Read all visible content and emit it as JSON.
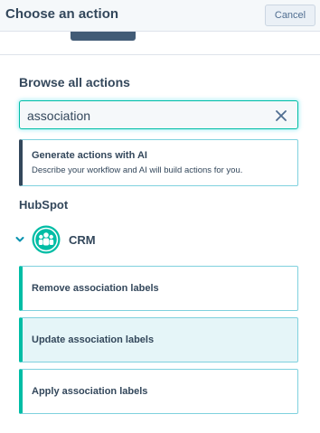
{
  "header": {
    "title": "Choose an action",
    "cancel_label": "Cancel"
  },
  "browse": {
    "title": "Browse all actions"
  },
  "search": {
    "value": "association",
    "placeholder": ""
  },
  "ai_card": {
    "title": "Generate actions with AI",
    "description": "Describe your workflow and AI will build actions for you."
  },
  "group": {
    "title": "HubSpot"
  },
  "category": {
    "label": "CRM",
    "icon": "crm-people-icon",
    "expanded": true
  },
  "actions": [
    {
      "label": "Remove association labels"
    },
    {
      "label": "Update association labels"
    },
    {
      "label": "Apply association labels"
    }
  ],
  "colors": {
    "accent": "#00bda5",
    "border": "#7fd1de",
    "text": "#33475b",
    "hover_bg": "#e5f5f8"
  }
}
